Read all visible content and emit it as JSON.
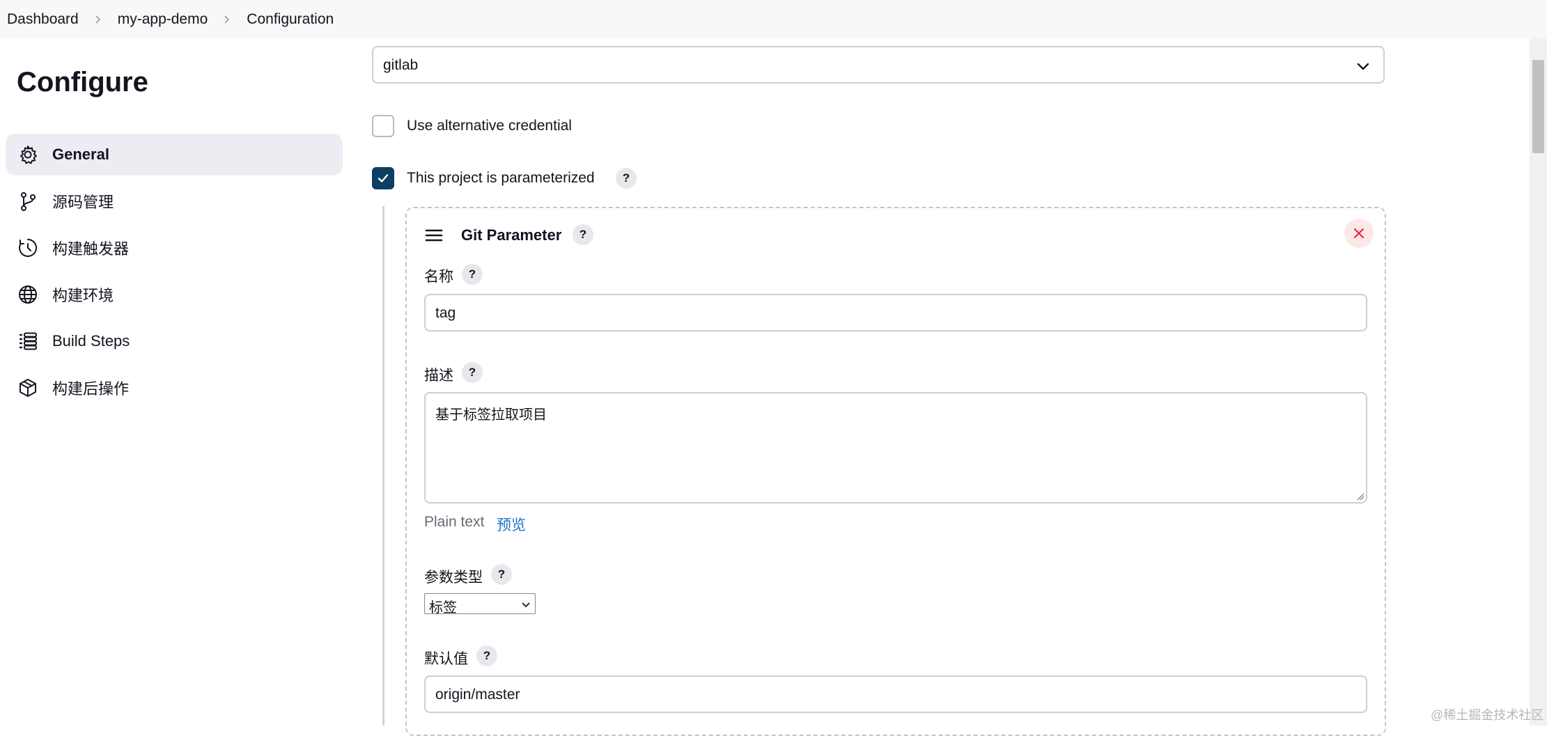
{
  "breadcrumb": {
    "items": [
      "Dashboard",
      "my-app-demo",
      "Configuration"
    ]
  },
  "sidebar": {
    "title": "Configure",
    "items": [
      {
        "label": "General",
        "icon": "gear-icon"
      },
      {
        "label": "源码管理",
        "icon": "git-branch-icon"
      },
      {
        "label": "构建触发器",
        "icon": "clock-icon"
      },
      {
        "label": "构建环境",
        "icon": "globe-icon"
      },
      {
        "label": "Build Steps",
        "icon": "list-icon"
      },
      {
        "label": "构建后操作",
        "icon": "package-icon"
      }
    ],
    "active_index": 0
  },
  "main": {
    "credential_select": {
      "value": "gitlab"
    },
    "alt_credential": {
      "label": "Use alternative credential",
      "checked": false
    },
    "parameterized": {
      "label": "This project is parameterized",
      "checked": true
    },
    "git_parameter": {
      "title": "Git Parameter",
      "name_label": "名称",
      "name_value": "tag",
      "desc_label": "描述",
      "desc_value": "基于标签拉取项目",
      "format_text": "Plain text",
      "preview_link": "预览",
      "type_label": "参数类型",
      "type_value": "标签",
      "default_label": "默认值",
      "default_value": "origin/master"
    },
    "help_symbol": "?"
  },
  "watermark": "@稀土掘金技术社区",
  "colors": {
    "accent": "#0b3f63",
    "link": "#1a73c8",
    "active_bg": "#ececf2",
    "delete_bg": "#fde8e8",
    "delete_icon": "#e0303c"
  }
}
